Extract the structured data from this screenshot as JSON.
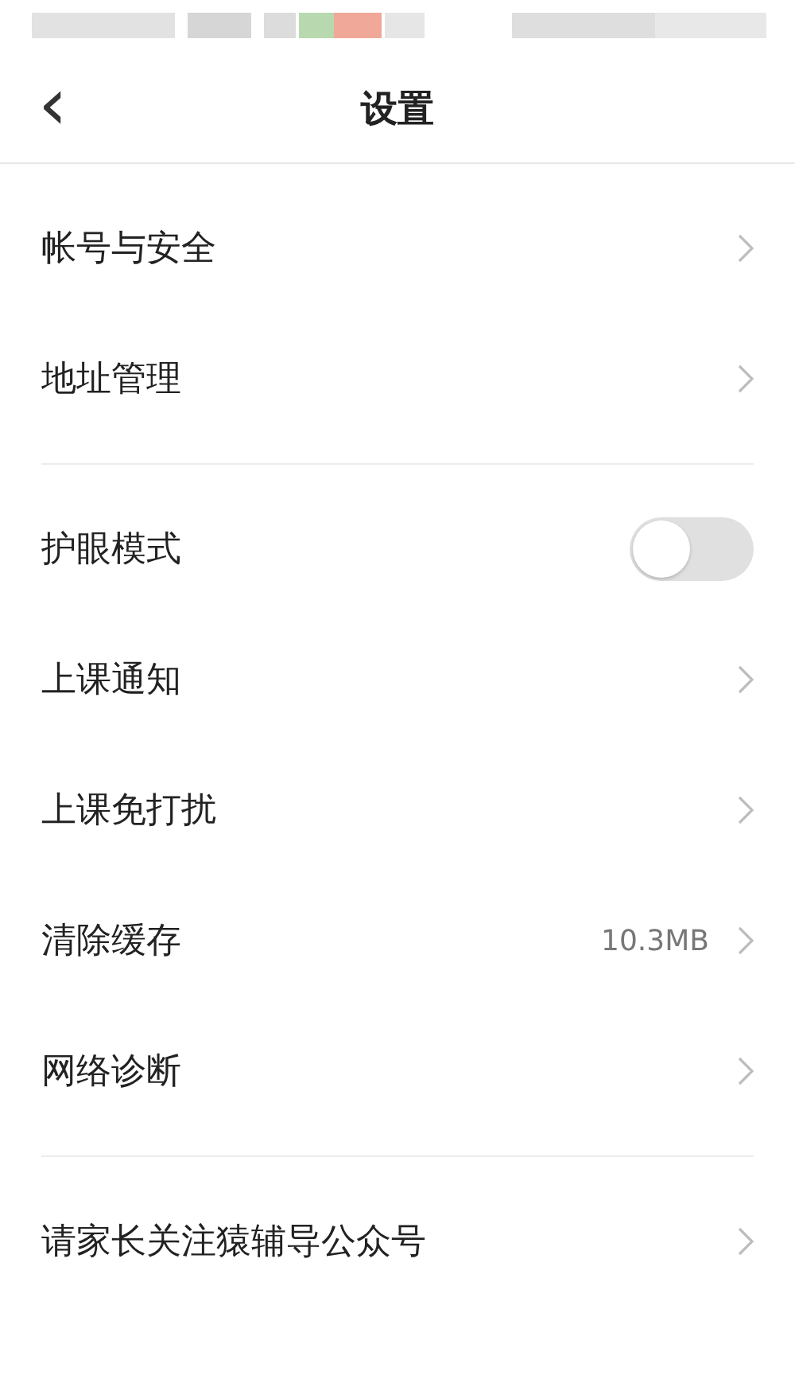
{
  "nav": {
    "back": "‹",
    "title": "设置"
  },
  "sections": [
    {
      "rows": [
        {
          "kind": "link",
          "label": "帐号与安全"
        },
        {
          "kind": "link",
          "label": "地址管理"
        }
      ]
    },
    {
      "rows": [
        {
          "kind": "toggle",
          "label": "护眼模式",
          "on": false
        },
        {
          "kind": "link",
          "label": "上课通知"
        },
        {
          "kind": "link",
          "label": "上课免打扰"
        },
        {
          "kind": "link",
          "label": "清除缓存",
          "value": "10.3MB"
        },
        {
          "kind": "link",
          "label": "网络诊断"
        }
      ]
    },
    {
      "rows": [
        {
          "kind": "link",
          "label": "请家长关注猿辅导公众号"
        }
      ]
    }
  ]
}
